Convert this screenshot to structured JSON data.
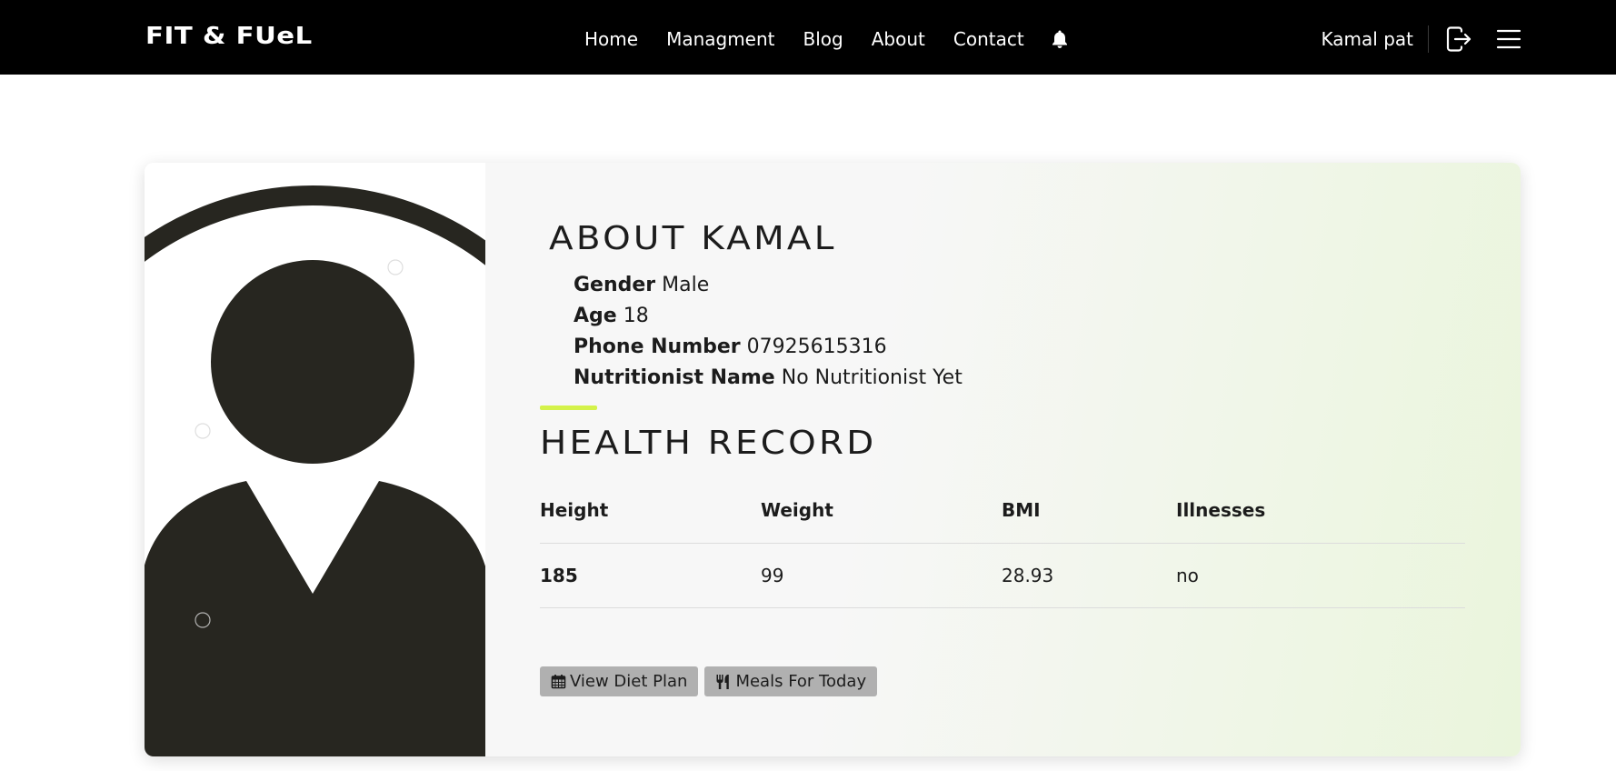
{
  "navbar": {
    "brand": "FIT & FUeL",
    "links": [
      "Home",
      "Managment",
      "Blog",
      "About",
      "Contact"
    ],
    "bell_icon": "bell-icon",
    "username": "Kamal pat",
    "logout_icon": "logout-icon",
    "menu_icon": "hamburger-menu-icon"
  },
  "profile": {
    "photo_icon": "user-avatar-placeholder",
    "about_title": "ABOUT KAMAL",
    "info": [
      {
        "label": "Gender",
        "value": "Male"
      },
      {
        "label": "Age",
        "value": "18"
      },
      {
        "label": "Phone Number",
        "value": "07925615316"
      },
      {
        "label": "Nutritionist Name",
        "value": "No Nutritionist Yet"
      }
    ],
    "health_title": "HEALTH RECORD",
    "health_table": {
      "headers": [
        "Height",
        "Weight",
        "BMI",
        "Illnesses"
      ],
      "row": [
        "185",
        "99",
        "28.93",
        "no"
      ]
    },
    "buttons": {
      "diet_plan": "View Diet Plan",
      "meals_today": "Meals For Today"
    }
  },
  "colors": {
    "navbar_bg": "#000000",
    "accent": "#d4f24a",
    "button_bg": "#b0b0b0"
  }
}
